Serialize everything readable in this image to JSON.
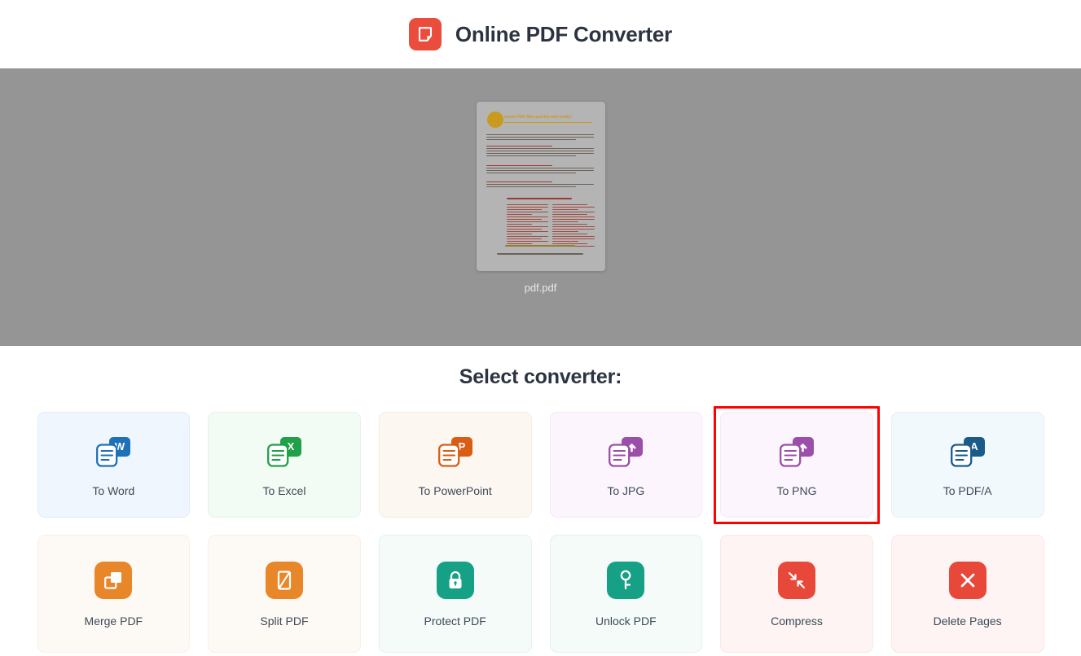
{
  "header": {
    "title": "Online PDF Converter",
    "logo_icon": "pdf-logo-icon",
    "logo_color": "#eb4d3d"
  },
  "preview": {
    "file_name": "pdf.pdf",
    "band_color": "#959595",
    "thumbnail_icon": "pdf-page-thumbnail"
  },
  "converter": {
    "section_title": "Select converter:",
    "selected": "To PNG",
    "selection_color": "#ff0000",
    "row1": [
      {
        "label": "To Word",
        "icon": "to-word-icon",
        "accent": "#1d71b8",
        "bg": "#f0f6fd",
        "border": "#e2ecf8",
        "badge": "W"
      },
      {
        "label": "To Excel",
        "icon": "to-excel-icon",
        "accent": "#21a04a",
        "bg": "#f2fbf4",
        "border": "#e3f4e8",
        "badge": "X"
      },
      {
        "label": "To PowerPoint",
        "icon": "to-powerpoint-icon",
        "accent": "#d95e14",
        "bg": "#fdf7f1",
        "border": "#f8ece0",
        "badge": "P"
      },
      {
        "label": "To JPG",
        "icon": "to-jpg-icon",
        "accent": "#9b4fa8",
        "bg": "#fcf5fd",
        "border": "#f5e8f7",
        "badge": "arrow"
      },
      {
        "label": "To PNG",
        "icon": "to-png-icon",
        "accent": "#9b4fa8",
        "bg": "#fcf5fd",
        "border": "#f5e8f7",
        "badge": "arrow"
      },
      {
        "label": "To PDF/A",
        "icon": "to-pdfa-icon",
        "accent": "#1a5c87",
        "bg": "#f2f9fc",
        "border": "#e3f0f6",
        "badge": "A"
      }
    ],
    "row2": [
      {
        "label": "Merge PDF",
        "icon": "merge-pdf-icon",
        "accent": "#e8862a",
        "bg": "#fdf9f4",
        "border": "#f9f0e4",
        "glyph": "merge"
      },
      {
        "label": "Split PDF",
        "icon": "split-pdf-icon",
        "accent": "#e8862a",
        "bg": "#fdf9f4",
        "border": "#f9f0e4",
        "glyph": "split"
      },
      {
        "label": "Protect PDF",
        "icon": "protect-pdf-icon",
        "accent": "#16a085",
        "bg": "#f4fbf9",
        "border": "#e4f3ef",
        "glyph": "lock"
      },
      {
        "label": "Unlock PDF",
        "icon": "unlock-pdf-icon",
        "accent": "#16a085",
        "bg": "#f4fbf9",
        "border": "#e4f3ef",
        "glyph": "key"
      },
      {
        "label": "Compress",
        "icon": "compress-icon",
        "accent": "#e8483a",
        "bg": "#fdf4f3",
        "border": "#fae7e4",
        "glyph": "compress"
      },
      {
        "label": "Delete Pages",
        "icon": "delete-pages-icon",
        "accent": "#e8483a",
        "bg": "#fdf4f3",
        "border": "#fae7e4",
        "glyph": "close"
      }
    ]
  }
}
